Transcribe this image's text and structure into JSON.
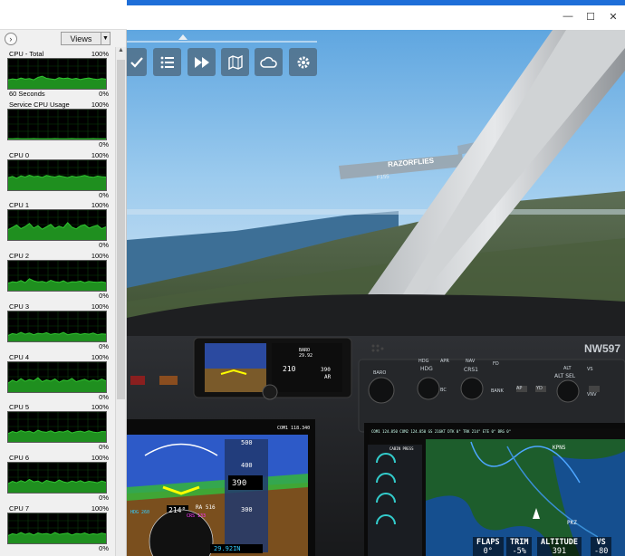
{
  "monitor": {
    "collapse_icon": "chevron-right-icon",
    "views_label": "Views",
    "graphs": [
      {
        "title": "CPU - Total",
        "max": "100%",
        "foot_left": "60 Seconds",
        "foot_right": "0%",
        "samples": [
          0.3,
          0.33,
          0.31,
          0.36,
          0.32,
          0.34,
          0.3,
          0.38,
          0.42,
          0.35,
          0.33,
          0.31,
          0.37,
          0.34,
          0.36,
          0.32,
          0.35,
          0.31,
          0.34,
          0.36,
          0.33,
          0.31,
          0.34,
          0.32
        ]
      },
      {
        "title": "Service CPU Usage",
        "max": "100%",
        "foot_left": "",
        "foot_right": "0%",
        "samples": [
          0.02,
          0.02,
          0.03,
          0.02,
          0.02,
          0.02,
          0.03,
          0.02,
          0.02,
          0.02,
          0.02,
          0.03,
          0.02,
          0.02,
          0.02,
          0.03,
          0.02,
          0.02,
          0.02,
          0.02,
          0.03,
          0.02,
          0.02,
          0.02
        ]
      },
      {
        "title": "CPU 0",
        "max": "100%",
        "foot_left": "",
        "foot_right": "0%",
        "samples": [
          0.42,
          0.46,
          0.4,
          0.48,
          0.44,
          0.5,
          0.45,
          0.47,
          0.43,
          0.49,
          0.46,
          0.44,
          0.48,
          0.45,
          0.42,
          0.47,
          0.44,
          0.46,
          0.49,
          0.45,
          0.43,
          0.47,
          0.45,
          0.44
        ]
      },
      {
        "title": "CPU 1",
        "max": "100%",
        "foot_left": "",
        "foot_right": "0%",
        "samples": [
          0.35,
          0.42,
          0.5,
          0.38,
          0.45,
          0.55,
          0.4,
          0.48,
          0.36,
          0.44,
          0.52,
          0.39,
          0.46,
          0.41,
          0.58,
          0.43,
          0.37,
          0.47,
          0.51,
          0.4,
          0.45,
          0.49,
          0.38,
          0.44
        ]
      },
      {
        "title": "CPU 2",
        "max": "100%",
        "foot_left": "",
        "foot_right": "0%",
        "samples": [
          0.25,
          0.3,
          0.28,
          0.34,
          0.27,
          0.4,
          0.33,
          0.29,
          0.31,
          0.27,
          0.35,
          0.3,
          0.28,
          0.33,
          0.26,
          0.3,
          0.29,
          0.32,
          0.27,
          0.31,
          0.29,
          0.28,
          0.3,
          0.27
        ]
      },
      {
        "title": "CPU 3",
        "max": "100%",
        "foot_left": "",
        "foot_right": "0%",
        "samples": [
          0.2,
          0.26,
          0.23,
          0.3,
          0.24,
          0.28,
          0.22,
          0.27,
          0.25,
          0.29,
          0.23,
          0.26,
          0.24,
          0.3,
          0.22,
          0.25,
          0.27,
          0.23,
          0.26,
          0.24,
          0.28,
          0.22,
          0.25,
          0.24
        ]
      },
      {
        "title": "CPU 4",
        "max": "100%",
        "foot_left": "",
        "foot_right": "0%",
        "samples": [
          0.3,
          0.4,
          0.34,
          0.45,
          0.36,
          0.42,
          0.38,
          0.48,
          0.35,
          0.41,
          0.37,
          0.44,
          0.33,
          0.4,
          0.38,
          0.46,
          0.35,
          0.39,
          0.43,
          0.36,
          0.41,
          0.37,
          0.44,
          0.38
        ]
      },
      {
        "title": "CPU 5",
        "max": "100%",
        "foot_left": "",
        "foot_right": "0%",
        "samples": [
          0.28,
          0.35,
          0.31,
          0.38,
          0.33,
          0.36,
          0.3,
          0.39,
          0.34,
          0.32,
          0.37,
          0.31,
          0.35,
          0.33,
          0.38,
          0.3,
          0.34,
          0.36,
          0.32,
          0.37,
          0.33,
          0.31,
          0.35,
          0.34
        ]
      },
      {
        "title": "CPU 6",
        "max": "100%",
        "foot_left": "",
        "foot_right": "0%",
        "samples": [
          0.3,
          0.38,
          0.33,
          0.4,
          0.35,
          0.44,
          0.36,
          0.39,
          0.32,
          0.41,
          0.37,
          0.34,
          0.42,
          0.36,
          0.33,
          0.39,
          0.35,
          0.4,
          0.34,
          0.38,
          0.36,
          0.33,
          0.39,
          0.35
        ]
      },
      {
        "title": "CPU 7",
        "max": "100%",
        "foot_left": "",
        "foot_right": "0%",
        "samples": [
          0.26,
          0.32,
          0.29,
          0.36,
          0.3,
          0.34,
          0.28,
          0.35,
          0.31,
          0.33,
          0.29,
          0.36,
          0.3,
          0.32,
          0.34,
          0.28,
          0.33,
          0.31,
          0.35,
          0.29,
          0.32,
          0.3,
          0.34,
          0.31
        ]
      }
    ],
    "graph_color": "#2fc52f",
    "graph_fill": "#1f8f1f"
  },
  "sim": {
    "toolbar_icons": [
      "check-icon",
      "list-icon",
      "fast-forward-icon",
      "map-icon",
      "cloud-icon",
      "gear-icon"
    ],
    "billboard": "RAZORFLIES",
    "billboard_sub": "F155",
    "tail_number": "NW597",
    "baro_label": "BARO",
    "baro_value": "29.92",
    "standby_alt": "210",
    "standby_vals": [
      "390",
      "AR"
    ],
    "autopilot": {
      "hdg": "HDG",
      "apr": "APR",
      "nav": "NAV",
      "crs1": "CRS1",
      "fd": "FD",
      "bc": "BC",
      "bank": "BANK",
      "ap": "AP",
      "yd": "YD",
      "alt": "ALT",
      "vs": "VS",
      "alt_sel": "ALT SEL",
      "vnv": "VNV",
      "baro": "BARO"
    },
    "pfd": {
      "com1": "COM1 118.340",
      "heading": "214°",
      "ra": "RA 516",
      "alt_ticks": [
        "500",
        "400",
        "390",
        "300"
      ],
      "alt_current": "390",
      "baro": "29.92IN",
      "speed": "HDG 260",
      "crs": "CRS 133"
    },
    "mfd": {
      "header": "COM1 124.850 COM2 124.850 GS 216KT DTK 0° TRK 214° ETE 0° BRG 0°",
      "engine_title": "CABIN PRESS",
      "waypoint": "KPNS",
      "waypoint2": "PKZ"
    },
    "hud": [
      {
        "k": "FLAPS",
        "v": "0°"
      },
      {
        "k": "TRIM",
        "v": "-5%"
      },
      {
        "k": "ALTITUDE",
        "v": "391"
      },
      {
        "k": "VS",
        "v": "-80"
      }
    ],
    "colors": {
      "sky": "#86bfe8",
      "button": "#4f6d87",
      "accent": "#1e6ed8"
    }
  }
}
